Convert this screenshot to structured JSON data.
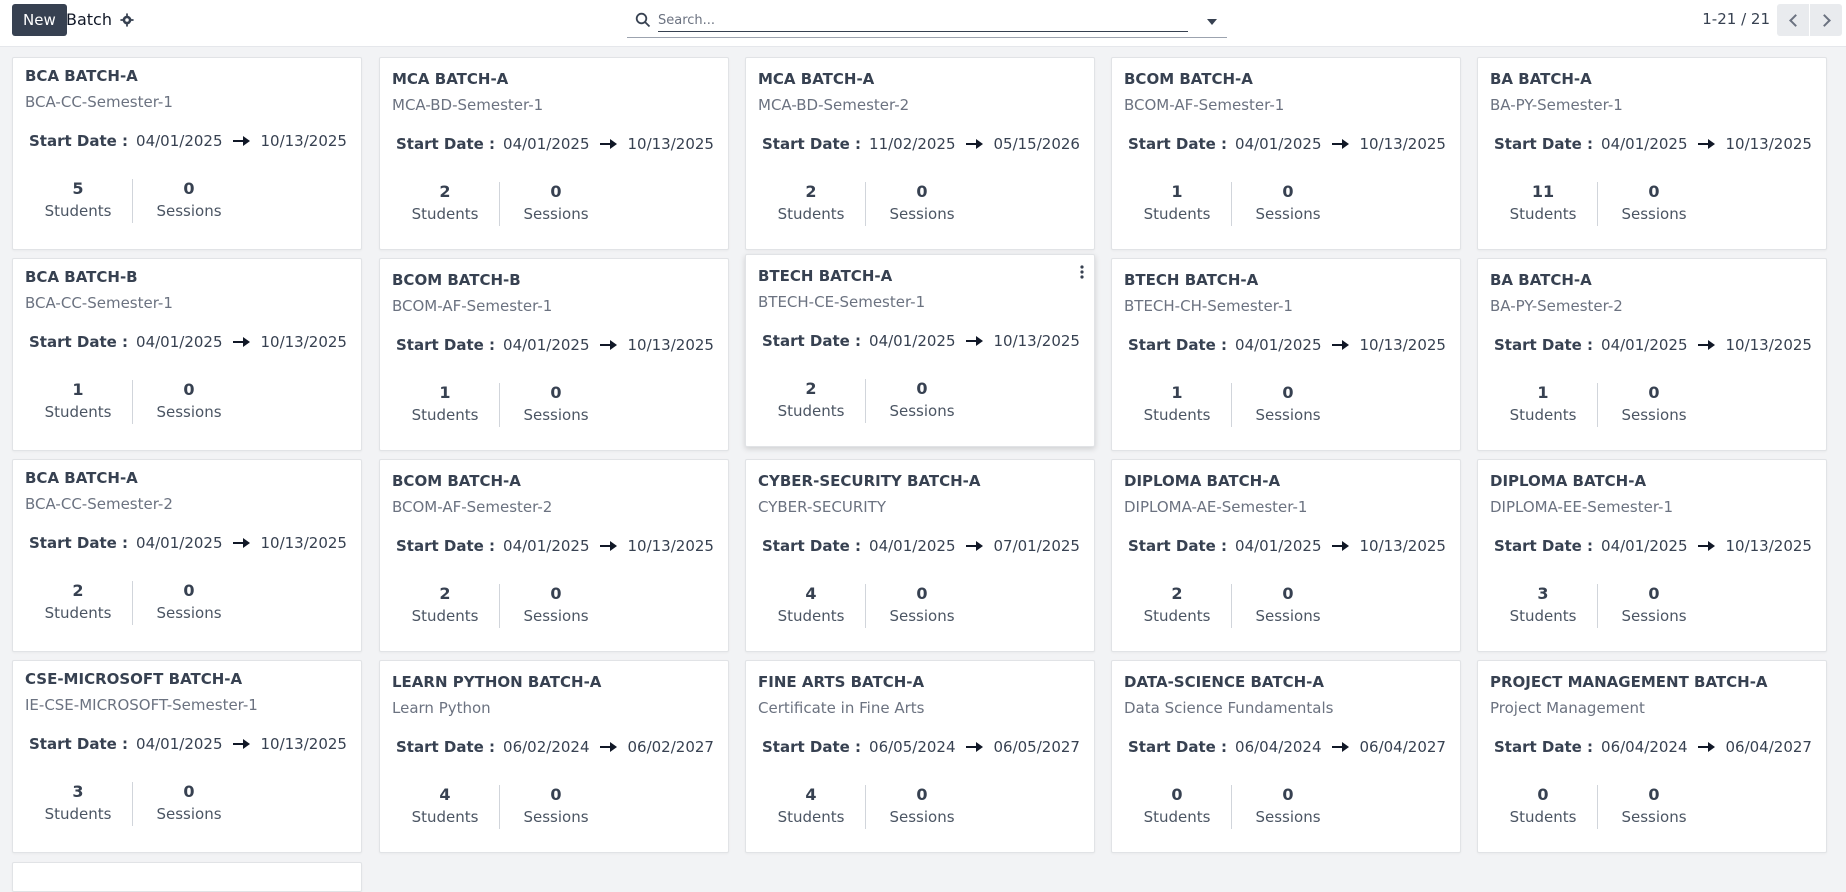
{
  "toolbar": {
    "new_label": "New",
    "breadcrumb": "Batch"
  },
  "search": {
    "placeholder": "Search..."
  },
  "pager": {
    "label": "1-21 / 21"
  },
  "labels": {
    "start_date": "Start Date :",
    "students": "Students",
    "sessions": "Sessions"
  },
  "icons": {
    "settings": "gear-icon",
    "search": "search-icon",
    "dropdown": "caret-down-icon",
    "prev": "chevron-left-icon",
    "next": "chevron-right-icon",
    "date_arrow": "arrow-right-icon",
    "card_menu": "kebab-icon"
  },
  "cards": [
    {
      "title": "BCA BATCH-A",
      "course": "BCA-CC-Semester-1",
      "start": "04/01/2025",
      "end": "10/13/2025",
      "students": "5",
      "sessions": "0"
    },
    {
      "title": "MCA BATCH-A",
      "course": "MCA-BD-Semester-1",
      "start": "04/01/2025",
      "end": "10/13/2025",
      "students": "2",
      "sessions": "0"
    },
    {
      "title": "MCA BATCH-A",
      "course": "MCA-BD-Semester-2",
      "start": "11/02/2025",
      "end": "05/15/2026",
      "students": "2",
      "sessions": "0"
    },
    {
      "title": "BCOM BATCH-A",
      "course": "BCOM-AF-Semester-1",
      "start": "04/01/2025",
      "end": "10/13/2025",
      "students": "1",
      "sessions": "0"
    },
    {
      "title": "BA BATCH-A",
      "course": "BA-PY-Semester-1",
      "start": "04/01/2025",
      "end": "10/13/2025",
      "students": "11",
      "sessions": "0"
    },
    {
      "title": "BCA BATCH-B",
      "course": "BCA-CC-Semester-1",
      "start": "04/01/2025",
      "end": "10/13/2025",
      "students": "1",
      "sessions": "0"
    },
    {
      "title": "BCOM BATCH-B",
      "course": "BCOM-AF-Semester-1",
      "start": "04/01/2025",
      "end": "10/13/2025",
      "students": "1",
      "sessions": "0"
    },
    {
      "title": "BTECH BATCH-A",
      "course": "BTECH-CE-Semester-1",
      "start": "04/01/2025",
      "end": "10/13/2025",
      "students": "2",
      "sessions": "0"
    },
    {
      "title": "BTECH BATCH-A",
      "course": "BTECH-CH-Semester-1",
      "start": "04/01/2025",
      "end": "10/13/2025",
      "students": "1",
      "sessions": "0"
    },
    {
      "title": "BA BATCH-A",
      "course": "BA-PY-Semester-2",
      "start": "04/01/2025",
      "end": "10/13/2025",
      "students": "1",
      "sessions": "0"
    },
    {
      "title": "BCA BATCH-A",
      "course": "BCA-CC-Semester-2",
      "start": "04/01/2025",
      "end": "10/13/2025",
      "students": "2",
      "sessions": "0"
    },
    {
      "title": "BCOM BATCH-A",
      "course": "BCOM-AF-Semester-2",
      "start": "04/01/2025",
      "end": "10/13/2025",
      "students": "2",
      "sessions": "0"
    },
    {
      "title": "CYBER-SECURITY BATCH-A",
      "course": "CYBER-SECURITY",
      "start": "04/01/2025",
      "end": "07/01/2025",
      "students": "4",
      "sessions": "0"
    },
    {
      "title": "DIPLOMA BATCH-A",
      "course": "DIPLOMA-AE-Semester-1",
      "start": "04/01/2025",
      "end": "10/13/2025",
      "students": "2",
      "sessions": "0"
    },
    {
      "title": "DIPLOMA BATCH-A",
      "course": "DIPLOMA-EE-Semester-1",
      "start": "04/01/2025",
      "end": "10/13/2025",
      "students": "3",
      "sessions": "0"
    },
    {
      "title": "CSE-MICROSOFT BATCH-A",
      "course": "IE-CSE-MICROSOFT-Semester-1",
      "start": "04/01/2025",
      "end": "10/13/2025",
      "students": "3",
      "sessions": "0"
    },
    {
      "title": "LEARN PYTHON BATCH-A",
      "course": "Learn Python",
      "start": "06/02/2024",
      "end": "06/02/2027",
      "students": "4",
      "sessions": "0"
    },
    {
      "title": "FINE ARTS BATCH-A",
      "course": "Certificate in Fine Arts",
      "start": "06/05/2024",
      "end": "06/05/2027",
      "students": "4",
      "sessions": "0"
    },
    {
      "title": "DATA-SCIENCE BATCH-A",
      "course": "Data Science Fundamentals",
      "start": "06/04/2024",
      "end": "06/04/2027",
      "students": "0",
      "sessions": "0"
    },
    {
      "title": "PROJECT MANAGEMENT BATCH-A",
      "course": "Project Management",
      "start": "06/04/2024",
      "end": "06/04/2027",
      "students": "0",
      "sessions": "0"
    },
    {
      "title": "",
      "course": "",
      "start": "",
      "end": "",
      "students": "",
      "sessions": ""
    }
  ]
}
